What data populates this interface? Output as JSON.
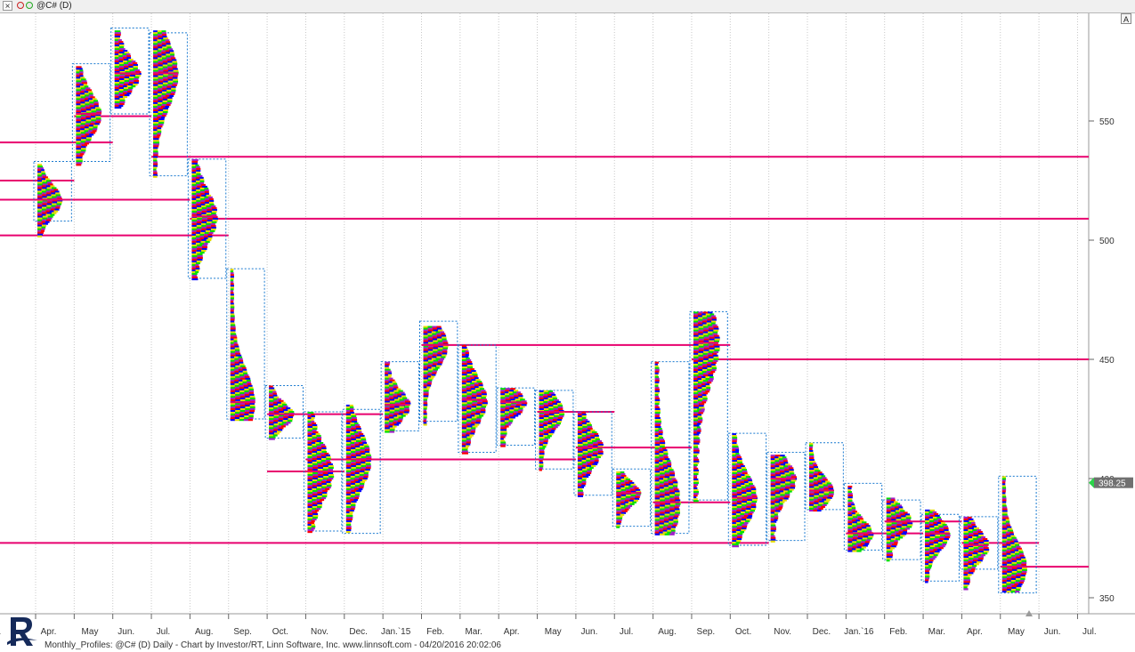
{
  "window": {
    "close_label": "×",
    "title": "@C# (D)",
    "scale_button": "A"
  },
  "footer": {
    "text": "Monthly_Profiles: @C# (D) Daily - Chart by Investor/RT, Linn Software, Inc. www.linnsoft.com - 04/20/2016 20:02:06"
  },
  "colors": {
    "profile": [
      "#e6dc00",
      "#00e000",
      "#a020c8",
      "#ff0000",
      "#0000ff"
    ],
    "poc_line": "#e8006e",
    "value_area_box": "#1a7ad0",
    "grid": "#c8c8c8",
    "price_tag_bg": "#707070"
  },
  "chart_data": {
    "type": "market-profile",
    "title": "",
    "xlabel": "",
    "ylabel": "",
    "ylim": [
      342,
      597
    ],
    "y_ticks": [
      350,
      400,
      450,
      500,
      550
    ],
    "x_ticks": [
      "Mar.",
      "Apr.",
      "May",
      "Jun.",
      "Jul.",
      "Aug.",
      "Sep.",
      "Oct.",
      "Nov.",
      "Dec.",
      "Jan.`15",
      "Feb.",
      "Mar.",
      "Apr.",
      "May",
      "Jun.",
      "Jul.",
      "Aug.",
      "Sep.",
      "Oct.",
      "Nov.",
      "Dec.",
      "Jan.`16",
      "Feb.",
      "Mar.",
      "Apr.",
      "May",
      "Jun.",
      "Jul."
    ],
    "last_price": "398.25",
    "profiles": [
      {
        "month": "Mar. 2014",
        "high": 532,
        "low": 502,
        "poc": 517,
        "va_high": 533,
        "va_low": 508
      },
      {
        "month": "Apr. 2014",
        "high": 573,
        "low": 532,
        "poc": 553,
        "va_high": 574,
        "va_low": 533
      },
      {
        "month": "May 2014",
        "high": 588,
        "low": 556,
        "poc": 570,
        "va_high": 589,
        "va_low": 553
      },
      {
        "month": "Jun. 2014",
        "high": 588,
        "low": 527,
        "poc": 570,
        "va_high": 587,
        "va_low": 527
      },
      {
        "month": "Jul. 2014",
        "high": 534,
        "low": 484,
        "poc": 510,
        "va_high": 534,
        "va_low": 484
      },
      {
        "month": "Aug. 2014",
        "high": 488,
        "low": 425,
        "poc": 432,
        "va_high": 488,
        "va_low": 425
      },
      {
        "month": "Sep. 2014",
        "high": 439,
        "low": 417,
        "poc": 427,
        "va_high": 439,
        "va_low": 417
      },
      {
        "month": "Oct. 2014",
        "high": 428,
        "low": 378,
        "poc": 403,
        "va_high": 428,
        "va_low": 378
      },
      {
        "month": "Nov. 2014",
        "high": 431,
        "low": 378,
        "poc": 408,
        "va_high": 429,
        "va_low": 377
      },
      {
        "month": "Dec. 2014",
        "high": 449,
        "low": 420,
        "poc": 431,
        "va_high": 449,
        "va_low": 420
      },
      {
        "month": "Jan. 2015",
        "high": 464,
        "low": 423,
        "poc": 456,
        "va_high": 466,
        "va_low": 424
      },
      {
        "month": "Feb. 2015",
        "high": 456,
        "low": 411,
        "poc": 433,
        "va_high": 456,
        "va_low": 411
      },
      {
        "month": "Mar. 2015",
        "high": 438,
        "low": 414,
        "poc": 432,
        "va_high": 438,
        "va_low": 414
      },
      {
        "month": "Apr. 2015",
        "high": 437,
        "low": 404,
        "poc": 428,
        "va_high": 437,
        "va_low": 404
      },
      {
        "month": "May 2015",
        "high": 428,
        "low": 393,
        "poc": 413,
        "va_high": 428,
        "va_low": 393
      },
      {
        "month": "Jun. 2015",
        "high": 403,
        "low": 380,
        "poc": 394,
        "va_high": 404,
        "va_low": 380
      },
      {
        "month": "Jul. 2015",
        "high": 449,
        "low": 377,
        "poc": 390,
        "va_high": 449,
        "va_low": 377
      },
      {
        "month": "Aug. 2015",
        "high": 470,
        "low": 391,
        "poc": 457,
        "va_high": 470,
        "va_low": 391
      },
      {
        "month": "Sep. 2015",
        "high": 419,
        "low": 372,
        "poc": 392,
        "va_high": 419,
        "va_low": 372
      },
      {
        "month": "Oct. 2015",
        "high": 410,
        "low": 374,
        "poc": 400,
        "va_high": 411,
        "va_low": 374
      },
      {
        "month": "Nov. 2015",
        "high": 415,
        "low": 387,
        "poc": 395,
        "va_high": 415,
        "va_low": 387
      },
      {
        "month": "Dec. 2015",
        "high": 397,
        "low": 370,
        "poc": 377,
        "va_high": 398,
        "va_low": 370
      },
      {
        "month": "Jan. 2016",
        "high": 392,
        "low": 366,
        "poc": 382,
        "va_high": 391,
        "va_low": 366
      },
      {
        "month": "Feb. 2016",
        "high": 387,
        "low": 357,
        "poc": 377,
        "va_high": 385,
        "va_low": 357
      },
      {
        "month": "Mar. 2016",
        "high": 384,
        "low": 354,
        "poc": 372,
        "va_high": 384,
        "va_low": 362
      },
      {
        "month": "Apr. 2016",
        "high": 401,
        "low": 353,
        "poc": 363,
        "va_high": 401,
        "va_low": 352
      }
    ],
    "poc_lines": [
      {
        "y": 552,
        "from": "Apr. 2014",
        "to": "May 2014"
      },
      {
        "y": 541,
        "from": "Mar. 2014",
        "to": "Apr. 2014"
      },
      {
        "y": 535,
        "from": "Jun. 2014",
        "to": "end"
      },
      {
        "y": 525,
        "from": "Mar. 2014",
        "to": "Mar. 2014"
      },
      {
        "y": 517,
        "from": "Mar. 2014",
        "to": "Jun. 2014"
      },
      {
        "y": 509,
        "from": "Jul. 2014",
        "to": "end"
      },
      {
        "y": 502,
        "from": "Mar. 2014",
        "to": "Jul. 2014"
      },
      {
        "y": 456,
        "from": "Jan. 2015",
        "to": "Aug. 2015"
      },
      {
        "y": 450,
        "from": "Aug. 2015",
        "to": "end"
      },
      {
        "y": 427,
        "from": "Sep. 2014",
        "to": "Nov. 2014"
      },
      {
        "y": 428,
        "from": "Apr. 2015",
        "to": "May 2015"
      },
      {
        "y": 413,
        "from": "May 2015",
        "to": "Jul. 2015"
      },
      {
        "y": 408,
        "from": "Oct. 2014",
        "to": "Apr. 2015"
      },
      {
        "y": 403,
        "from": "Sep. 2014",
        "to": "Oct. 2014"
      },
      {
        "y": 390,
        "from": "Jul. 2015",
        "to": "Aug. 2015"
      },
      {
        "y": 373,
        "from": "start",
        "to": "Sep. 2015"
      },
      {
        "y": 382,
        "from": "Jan. 2016",
        "to": "Feb. 2016"
      },
      {
        "y": 377,
        "from": "Dec. 2015",
        "to": "Jan. 2016"
      },
      {
        "y": 373,
        "from": "Mar. 2016",
        "to": "Apr. 2016"
      },
      {
        "y": 363,
        "from": "Apr. 2016",
        "to": "end"
      }
    ]
  }
}
